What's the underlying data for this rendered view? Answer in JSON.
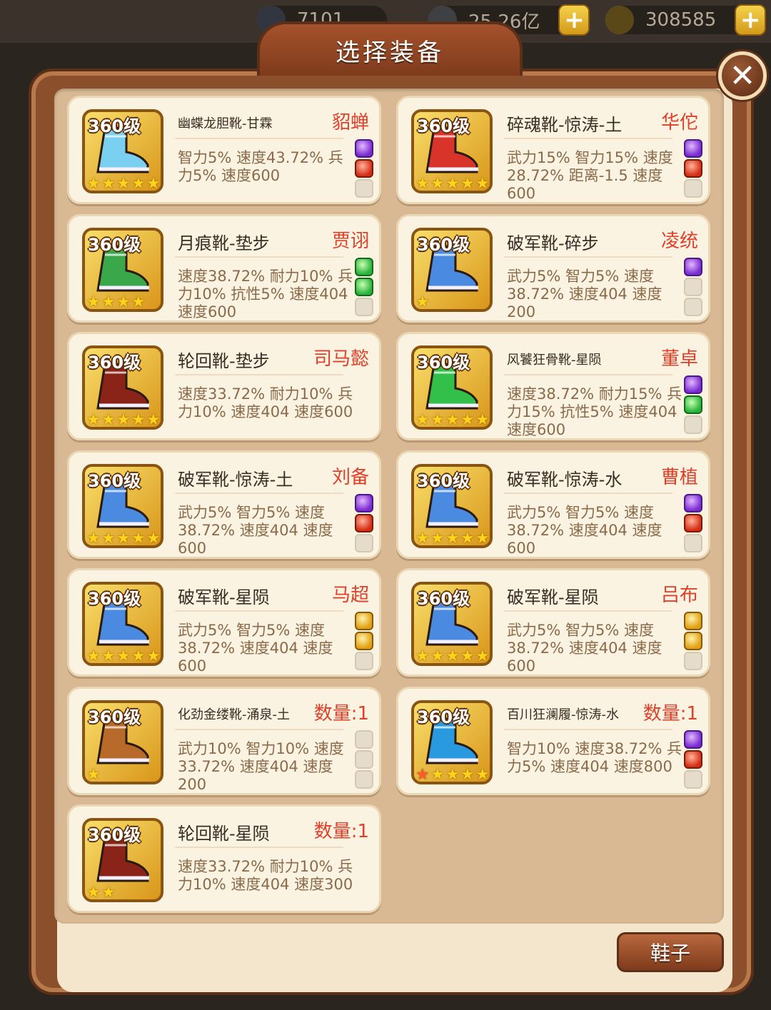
{
  "top_bar": {
    "resources": [
      {
        "icon": "stamina-icon",
        "value": "7101",
        "color": "#5a7aa8"
      },
      {
        "icon": "silver-coin-icon",
        "value": "25.26亿",
        "color": "#8a9bb0"
      },
      {
        "icon": "gold-ingot-icon",
        "value": "308585",
        "color": "#e8b424"
      }
    ]
  },
  "dialog": {
    "title": "选择装备",
    "close_icon": "close-icon",
    "category_button": "鞋子"
  },
  "equipment": [
    {
      "level": "360级",
      "name": "幽蝶龙胆靴-甘霖",
      "small": true,
      "owner": "貂蝉",
      "stars": 5,
      "red_stars": 0,
      "art": "#7ad0f0",
      "attrs": "智力5% 速度43.72% 兵力5% 速度600",
      "gems": [
        "purple",
        "red",
        "empty"
      ]
    },
    {
      "level": "360级",
      "name": "碎魂靴-惊涛-土",
      "small": false,
      "owner": "华佗",
      "stars": 5,
      "red_stars": 0,
      "art": "#d8342a",
      "attrs": "武力15% 智力15% 速度28.72% 距离-1.5 速度600",
      "gems": [
        "purple",
        "red",
        "empty"
      ]
    },
    {
      "level": "360级",
      "name": "月痕靴-垫步",
      "small": false,
      "owner": "贾诩",
      "stars": 4,
      "red_stars": 0,
      "art": "#3aa84a",
      "attrs": "速度38.72% 耐力10% 兵力10% 抗性5% 速度404 速度600",
      "gems": [
        "green",
        "green",
        "empty"
      ]
    },
    {
      "level": "360级",
      "name": "破军靴-碎步",
      "small": false,
      "owner": "凌统",
      "stars": 1,
      "red_stars": 0,
      "art": "#4a8ae0",
      "attrs": "武力5% 智力5% 速度38.72% 速度404 速度200",
      "gems": [
        "purple",
        "empty",
        "empty"
      ]
    },
    {
      "level": "360级",
      "name": "轮回靴-垫步",
      "small": false,
      "owner": "司马懿",
      "stars": 5,
      "red_stars": 0,
      "art": "#8a2418",
      "attrs": "速度33.72% 耐力10% 兵力10% 速度404 速度600",
      "gems": []
    },
    {
      "level": "360级",
      "name": "风饕狂骨靴-星陨",
      "small": true,
      "owner": "董卓",
      "stars": 5,
      "red_stars": 0,
      "art": "#32c04a",
      "attrs": "速度38.72% 耐力15% 兵力15% 抗性5% 速度404 速度600",
      "gems": [
        "purple",
        "green",
        "empty"
      ]
    },
    {
      "level": "360级",
      "name": "破军靴-惊涛-土",
      "small": false,
      "owner": "刘备",
      "stars": 5,
      "red_stars": 0,
      "art": "#4a8ae0",
      "attrs": "武力5% 智力5% 速度38.72% 速度404 速度600",
      "gems": [
        "purple",
        "red",
        "empty"
      ]
    },
    {
      "level": "360级",
      "name": "破军靴-惊涛-水",
      "small": false,
      "owner": "曹植",
      "stars": 5,
      "red_stars": 0,
      "art": "#4a8ae0",
      "attrs": "武力5% 智力5% 速度38.72% 速度404 速度600",
      "gems": [
        "purple",
        "red",
        "empty"
      ]
    },
    {
      "level": "360级",
      "name": "破军靴-星陨",
      "small": false,
      "owner": "马超",
      "stars": 5,
      "red_stars": 0,
      "art": "#4a8ae0",
      "attrs": "武力5% 智力5% 速度38.72% 速度404 速度600",
      "gems": [
        "gold",
        "gold",
        "empty"
      ]
    },
    {
      "level": "360级",
      "name": "破军靴-星陨",
      "small": false,
      "owner": "吕布",
      "stars": 5,
      "red_stars": 0,
      "art": "#4a8ae0",
      "attrs": "武力5% 智力5% 速度38.72% 速度404 速度600",
      "gems": [
        "gold",
        "gold",
        "empty"
      ]
    },
    {
      "level": "360级",
      "name": "化劲金缕靴-涌泉-土",
      "small": true,
      "owner": "数量:1",
      "stars": 1,
      "red_stars": 0,
      "art": "#b86a2a",
      "attrs": "武力10% 智力10% 速度33.72% 速度404 速度200",
      "gems": [
        "empty",
        "empty",
        "empty"
      ]
    },
    {
      "level": "360级",
      "name": "百川狂澜履-惊涛-水",
      "small": true,
      "owner": "数量:1",
      "stars": 5,
      "red_stars": 1,
      "art": "#2a9ae0",
      "attrs": "智力10% 速度38.72% 兵力5% 速度404 速度800",
      "gems": [
        "purple",
        "red",
        "empty"
      ]
    },
    {
      "level": "360级",
      "name": "轮回靴-星陨",
      "small": false,
      "owner": "数量:1",
      "stars": 2,
      "red_stars": 0,
      "art": "#8a2418",
      "attrs": "速度33.72% 耐力10% 兵力10% 速度404 速度300",
      "gems": []
    }
  ]
}
